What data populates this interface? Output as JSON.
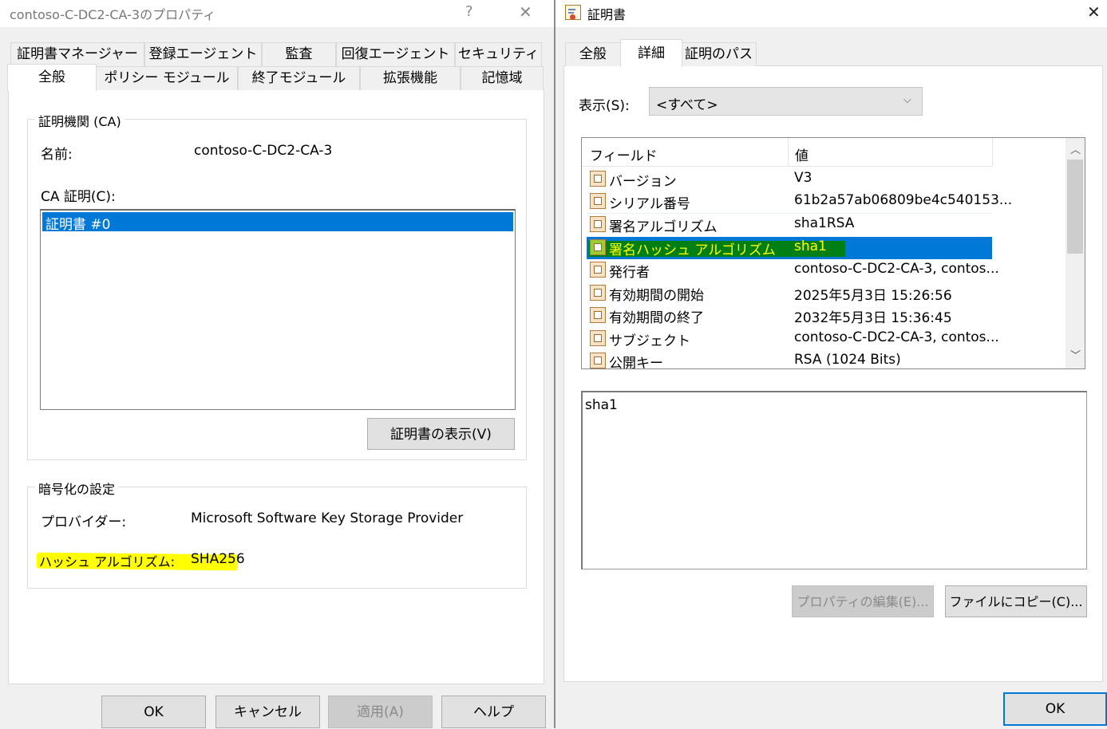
{
  "left_window": {
    "title": "contoso-C-DC2-CA-3のプロパティ",
    "help_glyph": "?",
    "close_glyph": "✕",
    "tabs_row1": [
      "証明書マネージャー",
      "登録エージェント",
      "監査",
      "回復エージェント",
      "セキュリティ"
    ],
    "tabs_row2": [
      "全般",
      "ポリシー モジュール",
      "終了モジュール",
      "拡張機能",
      "記憶域"
    ],
    "ca_group": {
      "title": "証明機関 (CA)",
      "name_label": "名前:",
      "name_value": "contoso-C-DC2-CA-3",
      "cert_label": "CA 証明(C):",
      "cert_items": [
        "証明書 #0"
      ],
      "view_button": "証明書の表示(V)"
    },
    "crypto_group": {
      "title": "暗号化の設定",
      "provider_label": "プロバイダー:",
      "provider_value": "Microsoft Software Key Storage Provider",
      "hash_label": "ハッシュ アルゴリズム:",
      "hash_value": "SHA256",
      "highlight_color": "#ffff00"
    },
    "buttons": {
      "ok": "OK",
      "cancel": "キャンセル",
      "apply": "適用(A)",
      "help": "ヘルプ"
    }
  },
  "right_window": {
    "title": "証明書",
    "close_glyph": "✕",
    "tabs": [
      "全般",
      "詳細",
      "証明のパス"
    ],
    "show_label": "表示(S):",
    "show_value": "<すべて>",
    "columns": [
      "フィールド",
      "値"
    ],
    "rows": [
      {
        "field": "バージョン",
        "value": "V3"
      },
      {
        "field": "シリアル番号",
        "value": "61b2a57ab06809be4c540153..."
      },
      {
        "field": "署名アルゴリズム",
        "value": "sha1RSA"
      },
      {
        "field": "署名ハッシュ アルゴリズム",
        "value": "sha1"
      },
      {
        "field": "発行者",
        "value": "contoso-C-DC2-CA-3, contos..."
      },
      {
        "field": "有効期間の開始",
        "value": "2025年5月3日 15:26:56"
      },
      {
        "field": "有効期間の終了",
        "value": "2032年5月3日 15:36:45"
      },
      {
        "field": "サブジェクト",
        "value": "contoso-C-DC2-CA-3, contos..."
      },
      {
        "field": "公開キー",
        "value": "RSA (1024 Bits)"
      }
    ],
    "selected_index": 3,
    "detail_text": "sha1",
    "buttons": {
      "edit": "プロパティの編集(E)...",
      "copy": "ファイルにコピー(C)...",
      "ok": "OK"
    },
    "selection_color": "#0078d7",
    "highlight_color": "#ffff00"
  }
}
